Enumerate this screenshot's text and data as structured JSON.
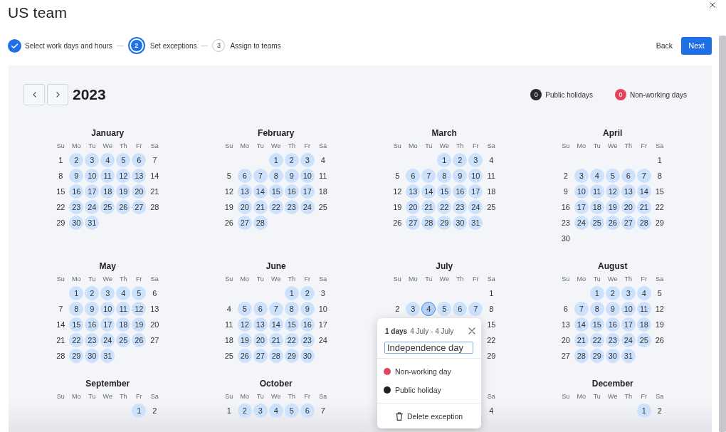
{
  "window": {
    "title": "US team"
  },
  "stepper": {
    "steps": [
      {
        "kind": "done",
        "label": "Select work days and hours"
      },
      {
        "kind": "current",
        "number": "2",
        "label": "Set exceptions"
      },
      {
        "kind": "upcoming",
        "number": "3",
        "label": "Assign to teams"
      }
    ]
  },
  "actions": {
    "back": "Back",
    "next": "Next"
  },
  "calendar": {
    "year": "2023",
    "legend": [
      {
        "count": "0",
        "label": "Public holidays",
        "color": "#292a2e"
      },
      {
        "count": "0",
        "label": "Non-working days",
        "color": "#e2445c"
      }
    ],
    "months": [
      {
        "name": "January",
        "weekdays": {
          "labels": [
            "Su",
            "Mo",
            "Tu",
            "We",
            "Th",
            "Fr",
            "Sa"
          ]
        },
        "weeks": [
          {
            "days": [
              {
                "day": "1",
                "working": false,
                "selected": false
              },
              {
                "day": "2",
                "working": true,
                "selected": false
              },
              {
                "day": "3",
                "working": true,
                "selected": false
              },
              {
                "day": "4",
                "working": true,
                "selected": false
              },
              {
                "day": "5",
                "working": true,
                "selected": false
              },
              {
                "day": "6",
                "working": true,
                "selected": false
              },
              {
                "day": "7",
                "working": false,
                "selected": false
              }
            ]
          },
          {
            "days": [
              {
                "day": "8",
                "working": false,
                "selected": false
              },
              {
                "day": "9",
                "working": true,
                "selected": false
              },
              {
                "day": "10",
                "working": true,
                "selected": false
              },
              {
                "day": "11",
                "working": true,
                "selected": false
              },
              {
                "day": "12",
                "working": true,
                "selected": false
              },
              {
                "day": "13",
                "working": true,
                "selected": false
              },
              {
                "day": "14",
                "working": false,
                "selected": false
              }
            ]
          },
          {
            "days": [
              {
                "day": "15",
                "working": false,
                "selected": false
              },
              {
                "day": "16",
                "working": true,
                "selected": false
              },
              {
                "day": "17",
                "working": true,
                "selected": false
              },
              {
                "day": "18",
                "working": true,
                "selected": false
              },
              {
                "day": "19",
                "working": true,
                "selected": false
              },
              {
                "day": "20",
                "working": true,
                "selected": false
              },
              {
                "day": "21",
                "working": false,
                "selected": false
              }
            ]
          },
          {
            "days": [
              {
                "day": "22",
                "working": false,
                "selected": false
              },
              {
                "day": "23",
                "working": true,
                "selected": false
              },
              {
                "day": "24",
                "working": true,
                "selected": false
              },
              {
                "day": "25",
                "working": true,
                "selected": false
              },
              {
                "day": "26",
                "working": true,
                "selected": false
              },
              {
                "day": "27",
                "working": true,
                "selected": false
              },
              {
                "day": "28",
                "working": false,
                "selected": false
              }
            ]
          },
          {
            "leading": false,
            "days": [
              {
                "day": "29",
                "working": false,
                "selected": false
              },
              {
                "day": "30",
                "working": true,
                "selected": false
              },
              {
                "day": "31",
                "working": true,
                "selected": false
              }
            ]
          }
        ]
      },
      {
        "name": "February",
        "weekdays": {
          "labels": [
            "Su",
            "Mo",
            "Tu",
            "We",
            "Th",
            "Fr",
            "Sa"
          ]
        },
        "weeks": [
          {
            "leading": true,
            "days": [
              {
                "day": "1",
                "working": true,
                "selected": false
              },
              {
                "day": "2",
                "working": true,
                "selected": false
              },
              {
                "day": "3",
                "working": true,
                "selected": false
              },
              {
                "day": "4",
                "working": false,
                "selected": false
              }
            ]
          },
          {
            "days": [
              {
                "day": "5",
                "working": false,
                "selected": false
              },
              {
                "day": "6",
                "working": true,
                "selected": false
              },
              {
                "day": "7",
                "working": true,
                "selected": false
              },
              {
                "day": "8",
                "working": true,
                "selected": false
              },
              {
                "day": "9",
                "working": true,
                "selected": false
              },
              {
                "day": "10",
                "working": true,
                "selected": false
              },
              {
                "day": "11",
                "working": false,
                "selected": false
              }
            ]
          },
          {
            "days": [
              {
                "day": "12",
                "working": false,
                "selected": false
              },
              {
                "day": "13",
                "working": true,
                "selected": false
              },
              {
                "day": "14",
                "working": true,
                "selected": false
              },
              {
                "day": "15",
                "working": true,
                "selected": false
              },
              {
                "day": "16",
                "working": true,
                "selected": false
              },
              {
                "day": "17",
                "working": true,
                "selected": false
              },
              {
                "day": "18",
                "working": false,
                "selected": false
              }
            ]
          },
          {
            "days": [
              {
                "day": "19",
                "working": false,
                "selected": false
              },
              {
                "day": "20",
                "working": true,
                "selected": false
              },
              {
                "day": "21",
                "working": true,
                "selected": false
              },
              {
                "day": "22",
                "working": true,
                "selected": false
              },
              {
                "day": "23",
                "working": true,
                "selected": false
              },
              {
                "day": "24",
                "working": true,
                "selected": false
              },
              {
                "day": "25",
                "working": false,
                "selected": false
              }
            ]
          },
          {
            "leading": false,
            "days": [
              {
                "day": "26",
                "working": false,
                "selected": false
              },
              {
                "day": "27",
                "working": true,
                "selected": false
              },
              {
                "day": "28",
                "working": true,
                "selected": false
              }
            ]
          }
        ]
      },
      {
        "name": "March",
        "weekdays": {
          "labels": [
            "Su",
            "Mo",
            "Tu",
            "We",
            "Th",
            "Fr",
            "Sa"
          ]
        },
        "weeks": [
          {
            "leading": true,
            "days": [
              {
                "day": "1",
                "working": true,
                "selected": false
              },
              {
                "day": "2",
                "working": true,
                "selected": false
              },
              {
                "day": "3",
                "working": true,
                "selected": false
              },
              {
                "day": "4",
                "working": false,
                "selected": false
              }
            ]
          },
          {
            "days": [
              {
                "day": "5",
                "working": false,
                "selected": false
              },
              {
                "day": "6",
                "working": true,
                "selected": false
              },
              {
                "day": "7",
                "working": true,
                "selected": false
              },
              {
                "day": "8",
                "working": true,
                "selected": false
              },
              {
                "day": "9",
                "working": true,
                "selected": false
              },
              {
                "day": "10",
                "working": true,
                "selected": false
              },
              {
                "day": "11",
                "working": false,
                "selected": false
              }
            ]
          },
          {
            "days": [
              {
                "day": "12",
                "working": false,
                "selected": false
              },
              {
                "day": "13",
                "working": true,
                "selected": false
              },
              {
                "day": "14",
                "working": true,
                "selected": false
              },
              {
                "day": "15",
                "working": true,
                "selected": false
              },
              {
                "day": "16",
                "working": true,
                "selected": false
              },
              {
                "day": "17",
                "working": true,
                "selected": false
              },
              {
                "day": "18",
                "working": false,
                "selected": false
              }
            ]
          },
          {
            "days": [
              {
                "day": "19",
                "working": false,
                "selected": false
              },
              {
                "day": "20",
                "working": true,
                "selected": false
              },
              {
                "day": "21",
                "working": true,
                "selected": false
              },
              {
                "day": "22",
                "working": true,
                "selected": false
              },
              {
                "day": "23",
                "working": true,
                "selected": false
              },
              {
                "day": "24",
                "working": true,
                "selected": false
              },
              {
                "day": "25",
                "working": false,
                "selected": false
              }
            ]
          },
          {
            "leading": false,
            "days": [
              {
                "day": "26",
                "working": false,
                "selected": false
              },
              {
                "day": "27",
                "working": true,
                "selected": false
              },
              {
                "day": "28",
                "working": true,
                "selected": false
              },
              {
                "day": "29",
                "working": true,
                "selected": false
              },
              {
                "day": "30",
                "working": true,
                "selected": false
              },
              {
                "day": "31",
                "working": true,
                "selected": false
              }
            ]
          }
        ]
      },
      {
        "name": "April",
        "weekdays": {
          "labels": [
            "Su",
            "Mo",
            "Tu",
            "We",
            "Th",
            "Fr",
            "Sa"
          ]
        },
        "weeks": [
          {
            "leading": true,
            "days": [
              {
                "day": "1",
                "working": false,
                "selected": false
              }
            ]
          },
          {
            "days": [
              {
                "day": "2",
                "working": false,
                "selected": false
              },
              {
                "day": "3",
                "working": true,
                "selected": false
              },
              {
                "day": "4",
                "working": true,
                "selected": false
              },
              {
                "day": "5",
                "working": true,
                "selected": false
              },
              {
                "day": "6",
                "working": true,
                "selected": false
              },
              {
                "day": "7",
                "working": true,
                "selected": false
              },
              {
                "day": "8",
                "working": false,
                "selected": false
              }
            ]
          },
          {
            "days": [
              {
                "day": "9",
                "working": false,
                "selected": false
              },
              {
                "day": "10",
                "working": true,
                "selected": false
              },
              {
                "day": "11",
                "working": true,
                "selected": false
              },
              {
                "day": "12",
                "working": true,
                "selected": false
              },
              {
                "day": "13",
                "working": true,
                "selected": false
              },
              {
                "day": "14",
                "working": true,
                "selected": false
              },
              {
                "day": "15",
                "working": false,
                "selected": false
              }
            ]
          },
          {
            "days": [
              {
                "day": "16",
                "working": false,
                "selected": false
              },
              {
                "day": "17",
                "working": true,
                "selected": false
              },
              {
                "day": "18",
                "working": true,
                "selected": false
              },
              {
                "day": "19",
                "working": true,
                "selected": false
              },
              {
                "day": "20",
                "working": true,
                "selected": false
              },
              {
                "day": "21",
                "working": true,
                "selected": false
              },
              {
                "day": "22",
                "working": false,
                "selected": false
              }
            ]
          },
          {
            "days": [
              {
                "day": "23",
                "working": false,
                "selected": false
              },
              {
                "day": "24",
                "working": true,
                "selected": false
              },
              {
                "day": "25",
                "working": true,
                "selected": false
              },
              {
                "day": "26",
                "working": true,
                "selected": false
              },
              {
                "day": "27",
                "working": true,
                "selected": false
              },
              {
                "day": "28",
                "working": true,
                "selected": false
              },
              {
                "day": "29",
                "working": false,
                "selected": false
              }
            ]
          },
          {
            "leading": false,
            "days": [
              {
                "day": "30",
                "working": false,
                "selected": false
              }
            ]
          }
        ]
      },
      {
        "name": "May",
        "weekdays": {
          "labels": [
            "Su",
            "Mo",
            "Tu",
            "We",
            "Th",
            "Fr",
            "Sa"
          ]
        },
        "weeks": [
          {
            "leading": true,
            "days": [
              {
                "day": "1",
                "working": true,
                "selected": false
              },
              {
                "day": "2",
                "working": true,
                "selected": false
              },
              {
                "day": "3",
                "working": true,
                "selected": false
              },
              {
                "day": "4",
                "working": true,
                "selected": false
              },
              {
                "day": "5",
                "working": true,
                "selected": false
              },
              {
                "day": "6",
                "working": false,
                "selected": false
              }
            ]
          },
          {
            "days": [
              {
                "day": "7",
                "working": false,
                "selected": false
              },
              {
                "day": "8",
                "working": true,
                "selected": false
              },
              {
                "day": "9",
                "working": true,
                "selected": false
              },
              {
                "day": "10",
                "working": true,
                "selected": false
              },
              {
                "day": "11",
                "working": true,
                "selected": false
              },
              {
                "day": "12",
                "working": true,
                "selected": false
              },
              {
                "day": "13",
                "working": false,
                "selected": false
              }
            ]
          },
          {
            "days": [
              {
                "day": "14",
                "working": false,
                "selected": false
              },
              {
                "day": "15",
                "working": true,
                "selected": false
              },
              {
                "day": "16",
                "working": true,
                "selected": false
              },
              {
                "day": "17",
                "working": true,
                "selected": false
              },
              {
                "day": "18",
                "working": true,
                "selected": false
              },
              {
                "day": "19",
                "working": true,
                "selected": false
              },
              {
                "day": "20",
                "working": false,
                "selected": false
              }
            ]
          },
          {
            "days": [
              {
                "day": "21",
                "working": false,
                "selected": false
              },
              {
                "day": "22",
                "working": true,
                "selected": false
              },
              {
                "day": "23",
                "working": true,
                "selected": false
              },
              {
                "day": "24",
                "working": true,
                "selected": false
              },
              {
                "day": "25",
                "working": true,
                "selected": false
              },
              {
                "day": "26",
                "working": true,
                "selected": false
              },
              {
                "day": "27",
                "working": false,
                "selected": false
              }
            ]
          },
          {
            "leading": false,
            "days": [
              {
                "day": "28",
                "working": false,
                "selected": false
              },
              {
                "day": "29",
                "working": true,
                "selected": false
              },
              {
                "day": "30",
                "working": true,
                "selected": false
              },
              {
                "day": "31",
                "working": true,
                "selected": false
              }
            ]
          }
        ]
      },
      {
        "name": "June",
        "weekdays": {
          "labels": [
            "Su",
            "Mo",
            "Tu",
            "We",
            "Th",
            "Fr",
            "Sa"
          ]
        },
        "weeks": [
          {
            "leading": true,
            "days": [
              {
                "day": "1",
                "working": true,
                "selected": false
              },
              {
                "day": "2",
                "working": true,
                "selected": false
              },
              {
                "day": "3",
                "working": false,
                "selected": false
              }
            ]
          },
          {
            "days": [
              {
                "day": "4",
                "working": false,
                "selected": false
              },
              {
                "day": "5",
                "working": true,
                "selected": false
              },
              {
                "day": "6",
                "working": true,
                "selected": false
              },
              {
                "day": "7",
                "working": true,
                "selected": false
              },
              {
                "day": "8",
                "working": true,
                "selected": false
              },
              {
                "day": "9",
                "working": true,
                "selected": false
              },
              {
                "day": "10",
                "working": false,
                "selected": false
              }
            ]
          },
          {
            "days": [
              {
                "day": "11",
                "working": false,
                "selected": false
              },
              {
                "day": "12",
                "working": true,
                "selected": false
              },
              {
                "day": "13",
                "working": true,
                "selected": false
              },
              {
                "day": "14",
                "working": true,
                "selected": false
              },
              {
                "day": "15",
                "working": true,
                "selected": false
              },
              {
                "day": "16",
                "working": true,
                "selected": false
              },
              {
                "day": "17",
                "working": false,
                "selected": false
              }
            ]
          },
          {
            "days": [
              {
                "day": "18",
                "working": false,
                "selected": false
              },
              {
                "day": "19",
                "working": true,
                "selected": false
              },
              {
                "day": "20",
                "working": true,
                "selected": false
              },
              {
                "day": "21",
                "working": true,
                "selected": false
              },
              {
                "day": "22",
                "working": true,
                "selected": false
              },
              {
                "day": "23",
                "working": true,
                "selected": false
              },
              {
                "day": "24",
                "working": false,
                "selected": false
              }
            ]
          },
          {
            "leading": false,
            "days": [
              {
                "day": "25",
                "working": false,
                "selected": false
              },
              {
                "day": "26",
                "working": true,
                "selected": false
              },
              {
                "day": "27",
                "working": true,
                "selected": false
              },
              {
                "day": "28",
                "working": true,
                "selected": false
              },
              {
                "day": "29",
                "working": true,
                "selected": false
              },
              {
                "day": "30",
                "working": true,
                "selected": false
              }
            ]
          }
        ]
      },
      {
        "name": "July",
        "weekdays": {
          "labels": [
            "Su",
            "Mo",
            "Tu",
            "We",
            "Th",
            "Fr",
            "Sa"
          ]
        },
        "weeks": [
          {
            "leading": true,
            "days": [
              {
                "day": "1",
                "working": false,
                "selected": false
              }
            ]
          },
          {
            "days": [
              {
                "day": "2",
                "working": false,
                "selected": false
              },
              {
                "day": "3",
                "working": true,
                "selected": false
              },
              {
                "day": "4",
                "working": true,
                "selected": true
              },
              {
                "day": "5",
                "working": true,
                "selected": false
              },
              {
                "day": "6",
                "working": true,
                "selected": false
              },
              {
                "day": "7",
                "working": true,
                "selected": false
              },
              {
                "day": "8",
                "working": false,
                "selected": false
              }
            ]
          },
          {
            "leading": true,
            "days": [
              {
                "day": "15",
                "working": false,
                "selected": false
              }
            ]
          },
          {
            "leading": true,
            "days": [
              {
                "day": "22",
                "working": false,
                "selected": false
              }
            ]
          },
          {
            "leading": true,
            "days": [
              {
                "day": "29",
                "working": false,
                "selected": false
              }
            ]
          }
        ]
      },
      {
        "name": "August",
        "weekdays": {
          "labels": [
            "Su",
            "Mo",
            "Tu",
            "We",
            "Th",
            "Fr",
            "Sa"
          ]
        },
        "weeks": [
          {
            "leading": true,
            "days": [
              {
                "day": "1",
                "working": true,
                "selected": false
              },
              {
                "day": "2",
                "working": true,
                "selected": false
              },
              {
                "day": "3",
                "working": true,
                "selected": false
              },
              {
                "day": "4",
                "working": true,
                "selected": false
              },
              {
                "day": "5",
                "working": false,
                "selected": false
              }
            ]
          },
          {
            "days": [
              {
                "day": "6",
                "working": false,
                "selected": false
              },
              {
                "day": "7",
                "working": true,
                "selected": false
              },
              {
                "day": "8",
                "working": true,
                "selected": false
              },
              {
                "day": "9",
                "working": true,
                "selected": false
              },
              {
                "day": "10",
                "working": true,
                "selected": false
              },
              {
                "day": "11",
                "working": true,
                "selected": false
              },
              {
                "day": "12",
                "working": false,
                "selected": false
              }
            ]
          },
          {
            "days": [
              {
                "day": "13",
                "working": false,
                "selected": false
              },
              {
                "day": "14",
                "working": true,
                "selected": false
              },
              {
                "day": "15",
                "working": true,
                "selected": false
              },
              {
                "day": "16",
                "working": true,
                "selected": false
              },
              {
                "day": "17",
                "working": true,
                "selected": false
              },
              {
                "day": "18",
                "working": true,
                "selected": false
              },
              {
                "day": "19",
                "working": false,
                "selected": false
              }
            ]
          },
          {
            "days": [
              {
                "day": "20",
                "working": false,
                "selected": false
              },
              {
                "day": "21",
                "working": true,
                "selected": false
              },
              {
                "day": "22",
                "working": true,
                "selected": false
              },
              {
                "day": "23",
                "working": true,
                "selected": false
              },
              {
                "day": "24",
                "working": true,
                "selected": false
              },
              {
                "day": "25",
                "working": true,
                "selected": false
              },
              {
                "day": "26",
                "working": false,
                "selected": false
              }
            ]
          },
          {
            "leading": false,
            "days": [
              {
                "day": "27",
                "working": false,
                "selected": false
              },
              {
                "day": "28",
                "working": true,
                "selected": false
              },
              {
                "day": "29",
                "working": true,
                "selected": false
              },
              {
                "day": "30",
                "working": true,
                "selected": false
              },
              {
                "day": "31",
                "working": true,
                "selected": false
              }
            ]
          }
        ]
      },
      {
        "name": "September",
        "weekdays": {
          "labels": [
            "Su",
            "Mo",
            "Tu",
            "We",
            "Th",
            "Fr",
            "Sa"
          ]
        },
        "weeks": [
          {
            "leading": true,
            "days": [
              {
                "day": "1",
                "working": true,
                "selected": false
              },
              {
                "day": "2",
                "working": false,
                "selected": false
              }
            ]
          }
        ]
      },
      {
        "name": "October",
        "weekdays": {
          "labels": [
            "Su",
            "Mo",
            "Tu",
            "We",
            "Th",
            "Fr",
            "Sa"
          ]
        },
        "weeks": [
          {
            "days": [
              {
                "day": "1",
                "working": false,
                "selected": false
              },
              {
                "day": "2",
                "working": true,
                "selected": false
              },
              {
                "day": "3",
                "working": true,
                "selected": false
              },
              {
                "day": "4",
                "working": true,
                "selected": false
              },
              {
                "day": "5",
                "working": true,
                "selected": false
              },
              {
                "day": "6",
                "working": true,
                "selected": false
              },
              {
                "day": "7",
                "working": false,
                "selected": false
              }
            ]
          }
        ]
      },
      {
        "weekdays": {
          "leading": true,
          "labels": [
            "Sa"
          ]
        },
        "weeks": [
          {
            "leading": true,
            "days": [
              {
                "day": "4",
                "working": false,
                "selected": false
              }
            ]
          }
        ]
      },
      {
        "name": "December",
        "weekdays": {
          "labels": [
            "Su",
            "Mo",
            "Tu",
            "We",
            "Th",
            "Fr",
            "Sa"
          ]
        },
        "weeks": [
          {
            "leading": true,
            "days": [
              {
                "day": "1",
                "working": true,
                "selected": false
              },
              {
                "day": "2",
                "working": false,
                "selected": false
              }
            ]
          }
        ]
      }
    ]
  },
  "exception_popup": {
    "day_count": "1 days",
    "range": "4 July - 4 July",
    "name_input": {
      "value": "Independence day"
    },
    "types": [
      {
        "label": "Non-working day",
        "color": "#e2445c"
      },
      {
        "label": "Public holiday",
        "color": "#1f1f22"
      }
    ],
    "delete_label": "Delete exception"
  }
}
